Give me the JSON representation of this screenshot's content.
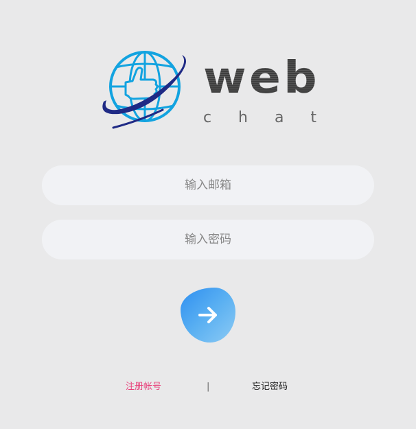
{
  "logo": {
    "word": "web",
    "sub_letters": [
      "c",
      "h",
      "a",
      "t"
    ]
  },
  "form": {
    "email_placeholder": "输入邮箱",
    "password_placeholder": "输入密码",
    "submit_icon": "arrow-right-icon"
  },
  "footer": {
    "register_label": "注册帐号",
    "divider": "|",
    "forgot_label": "忘记密码"
  },
  "colors": {
    "background": "#e9e9ea",
    "input_background": "#f1f2f5",
    "register_link": "#e8407a",
    "button_gradient_start": "#2f8ff0",
    "button_gradient_end": "#8ccaf4",
    "globe_blue": "#12a3e0",
    "globe_navy": "#1f2a85"
  }
}
